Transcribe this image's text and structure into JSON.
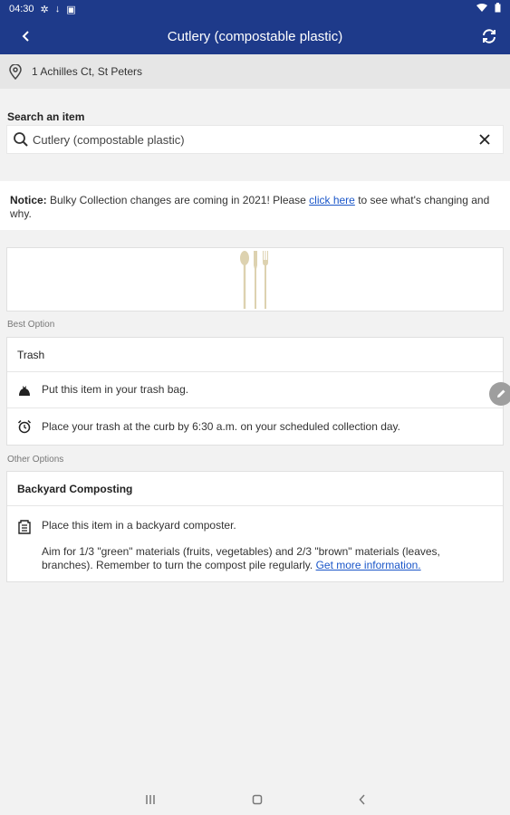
{
  "status_bar": {
    "time": "04:30"
  },
  "app_bar": {
    "title": "Cutlery (compostable plastic)"
  },
  "address": "1 Achilles Ct, St Peters",
  "search": {
    "label": "Search an item",
    "value": "Cutlery (compostable plastic)"
  },
  "notice": {
    "label": "Notice:",
    "text_before": " Bulky Collection changes are coming in 2021! Please ",
    "link": "click here",
    "text_after": " to see what's changing and why."
  },
  "best_option": {
    "section_label": "Best Option",
    "title": "Trash",
    "rows": [
      {
        "icon": "trash-bag-icon",
        "text": "Put this item in your trash bag."
      },
      {
        "icon": "alarm-clock-icon",
        "text": "Place your trash at the curb by 6:30 a.m. on your scheduled collection day."
      }
    ]
  },
  "other_options": {
    "section_label": "Other Options",
    "title": "Backyard Composting",
    "row_text": "Place this item in a backyard composter.",
    "detail_text": "Aim for 1/3 \"green\" materials (fruits, vegetables) and 2/3 \"brown\" materials (leaves, branches). Remember to turn the compost pile regularly. ",
    "link": "Get more information."
  },
  "colors": {
    "brand": "#1e3a8a",
    "link": "#1a56c9"
  }
}
